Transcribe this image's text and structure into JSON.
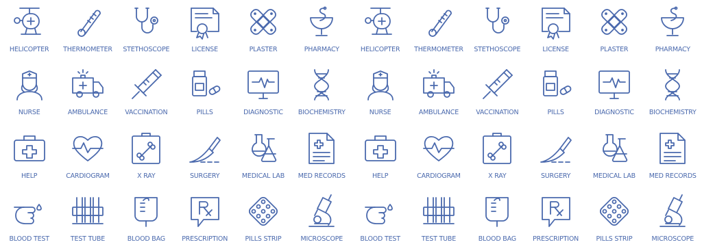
{
  "accent_color": "#4a69ad",
  "rows": [
    [
      {
        "label": "HELICOPTER",
        "icon": "helicopter-icon"
      },
      {
        "label": "THERMOMETER",
        "icon": "thermometer-icon"
      },
      {
        "label": "STETHOSCOPE",
        "icon": "stethoscope-icon"
      },
      {
        "label": "LICENSE",
        "icon": "license-icon"
      },
      {
        "label": "PLASTER",
        "icon": "plaster-icon"
      },
      {
        "label": "PHARMACY",
        "icon": "pharmacy-icon"
      },
      {
        "label": "HELICOPTER",
        "icon": "helicopter-icon"
      },
      {
        "label": "THERMOMETER",
        "icon": "thermometer-icon"
      },
      {
        "label": "STETHOSCOPE",
        "icon": "stethoscope-icon"
      },
      {
        "label": "LICENSE",
        "icon": "license-icon"
      },
      {
        "label": "PLASTER",
        "icon": "plaster-icon"
      },
      {
        "label": "PHARMACY",
        "icon": "pharmacy-icon"
      }
    ],
    [
      {
        "label": "NURSE",
        "icon": "nurse-icon"
      },
      {
        "label": "AMBULANCE",
        "icon": "ambulance-icon"
      },
      {
        "label": "VACCINATION",
        "icon": "syringe-icon"
      },
      {
        "label": "PILLS",
        "icon": "pills-icon"
      },
      {
        "label": "DIAGNOSTIC",
        "icon": "monitor-icon"
      },
      {
        "label": "BIOCHEMISTRY",
        "icon": "dna-icon"
      },
      {
        "label": "NURSE",
        "icon": "nurse-icon"
      },
      {
        "label": "AMBULANCE",
        "icon": "ambulance-icon"
      },
      {
        "label": "VACCINATION",
        "icon": "syringe-icon"
      },
      {
        "label": "PILLS",
        "icon": "pills-icon"
      },
      {
        "label": "DIAGNOSTIC",
        "icon": "monitor-icon"
      },
      {
        "label": "BIOCHEMISTRY",
        "icon": "dna-icon"
      }
    ],
    [
      {
        "label": "HELP",
        "icon": "first-aid-kit-icon"
      },
      {
        "label": "CARDIOGRAM",
        "icon": "heart-pulse-icon"
      },
      {
        "label": "X RAY",
        "icon": "xray-bone-icon"
      },
      {
        "label": "SURGERY",
        "icon": "scalpel-icon"
      },
      {
        "label": "MEDICAL LAB",
        "icon": "flasks-icon"
      },
      {
        "label": "MED RECORDS",
        "icon": "medical-record-icon"
      },
      {
        "label": "HELP",
        "icon": "first-aid-kit-icon"
      },
      {
        "label": "CARDIOGRAM",
        "icon": "heart-pulse-icon"
      },
      {
        "label": "X RAY",
        "icon": "xray-bone-icon"
      },
      {
        "label": "SURGERY",
        "icon": "scalpel-icon"
      },
      {
        "label": "MEDICAL LAB",
        "icon": "flasks-icon"
      },
      {
        "label": "MED RECORDS",
        "icon": "medical-record-icon"
      }
    ],
    [
      {
        "label": "BLOOD TEST",
        "icon": "finger-prick-icon"
      },
      {
        "label": "TEST TUBE",
        "icon": "test-tubes-icon"
      },
      {
        "label": "BLOOD BAG",
        "icon": "blood-bag-icon"
      },
      {
        "label": "PRESCRIPTION",
        "icon": "prescription-icon"
      },
      {
        "label": "PILLS STRIP",
        "icon": "pill-strip-icon"
      },
      {
        "label": "MICROSCOPE",
        "icon": "microscope-icon"
      },
      {
        "label": "BLOOD TEST",
        "icon": "finger-prick-icon"
      },
      {
        "label": "TEST TUBE",
        "icon": "test-tubes-icon"
      },
      {
        "label": "BLOOD BAG",
        "icon": "blood-bag-icon"
      },
      {
        "label": "PRESCRIPTION",
        "icon": "prescription-icon"
      },
      {
        "label": "PILLS STRIP",
        "icon": "pill-strip-icon"
      },
      {
        "label": "MICROSCOPE",
        "icon": "microscope-icon"
      }
    ]
  ]
}
